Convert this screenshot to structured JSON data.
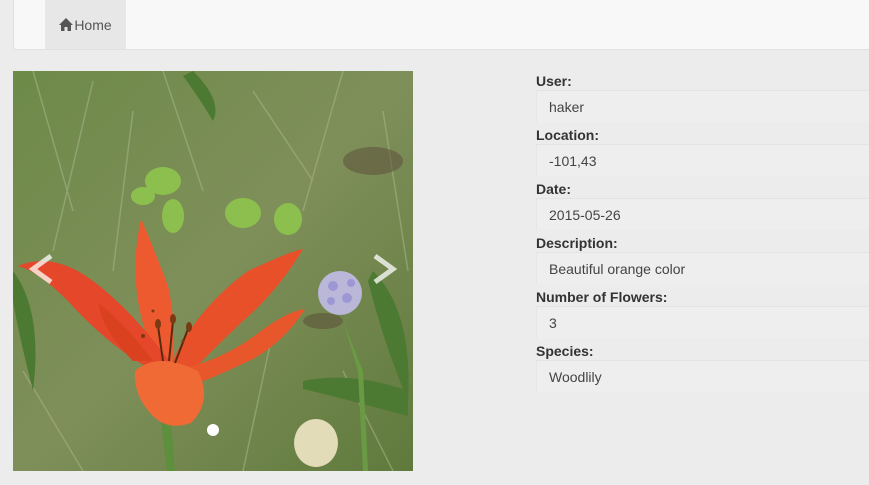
{
  "nav": {
    "home_label": "Home",
    "home_icon": "home-icon"
  },
  "photo": {
    "icons": [
      "chevron-left-icon",
      "chevron-right-icon",
      "carousel-dot-icon"
    ]
  },
  "details": {
    "user_label": "User:",
    "user_value": "haker",
    "location_label": "Location:",
    "location_value": "-101,43",
    "date_label": "Date:",
    "date_value": "2015-05-26",
    "description_label": "Description:",
    "description_value": "Beautiful orange color",
    "flowers_label": "Number of Flowers:",
    "flowers_value": "3",
    "species_label": "Species:",
    "species_value": "Woodlily"
  },
  "colors": {
    "background": "#ececec",
    "navbar": "#f8f8f8",
    "nav_active": "#e7e7e7",
    "flower": "#e8502a"
  }
}
